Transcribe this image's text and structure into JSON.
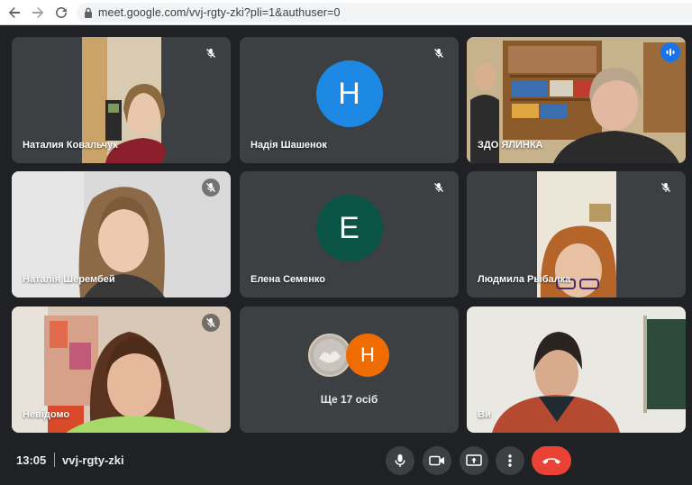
{
  "browser": {
    "url": "meet.google.com/vvj-rgty-zki?pli=1&authuser=0"
  },
  "tiles": [
    {
      "name": "Наталия Ковальчук",
      "mic": "muted"
    },
    {
      "name": "Надія Шашенок",
      "mic": "muted",
      "avatar_letter": "Н",
      "avatar_color": "#1e88e5"
    },
    {
      "name": "ЗДО ЯЛИНКА",
      "mic": "speaking"
    },
    {
      "name": "Наталія Шерембей",
      "mic": "muted"
    },
    {
      "name": "Елена Семенко",
      "mic": "muted",
      "avatar_letter": "Е",
      "avatar_color": "#0b5345"
    },
    {
      "name": "Людмила Рыбалка",
      "mic": "muted"
    },
    {
      "name": "Невідомо",
      "mic": "muted"
    },
    {
      "overflow_label": "Ще 17 осіб",
      "avatar_letter": "Н",
      "avatar_color": "#ef6c00"
    },
    {
      "name": "Ви",
      "mic": "on"
    }
  ],
  "bottom_bar": {
    "time": "13:05",
    "meeting_code": "vvj-rgty-zki",
    "controls": [
      "mic-button",
      "camera-button",
      "present-button",
      "more-options-button",
      "leave-call-button"
    ]
  },
  "colors": {
    "background": "#202124",
    "tile": "#3c4043",
    "active_border": "#8ab4f8",
    "hangup": "#ea4335"
  }
}
